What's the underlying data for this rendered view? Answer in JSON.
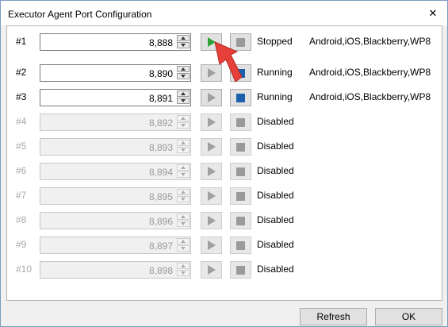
{
  "window": {
    "title": "Executor Agent Port Configuration",
    "close_glyph": "✕"
  },
  "rows": [
    {
      "label": "#1",
      "port": "8,888",
      "status": "Stopped",
      "platforms": "Android,iOS,Blackberry,WP8",
      "enabled": true,
      "play_active": true,
      "stop_active": false
    },
    {
      "label": "#2",
      "port": "8,890",
      "status": "Running",
      "platforms": "Android,iOS,Blackberry,WP8",
      "enabled": true,
      "play_active": false,
      "stop_active": true
    },
    {
      "label": "#3",
      "port": "8,891",
      "status": "Running",
      "platforms": "Android,iOS,Blackberry,WP8",
      "enabled": true,
      "play_active": false,
      "stop_active": true
    },
    {
      "label": "#4",
      "port": "8,892",
      "status": "Disabled",
      "platforms": "",
      "enabled": false,
      "play_active": false,
      "stop_active": false
    },
    {
      "label": "#5",
      "port": "8,893",
      "status": "Disabled",
      "platforms": "",
      "enabled": false,
      "play_active": false,
      "stop_active": false
    },
    {
      "label": "#6",
      "port": "8,894",
      "status": "Disabled",
      "platforms": "",
      "enabled": false,
      "play_active": false,
      "stop_active": false
    },
    {
      "label": "#7",
      "port": "8,895",
      "status": "Disabled",
      "platforms": "",
      "enabled": false,
      "play_active": false,
      "stop_active": false
    },
    {
      "label": "#8",
      "port": "8,896",
      "status": "Disabled",
      "platforms": "",
      "enabled": false,
      "play_active": false,
      "stop_active": false
    },
    {
      "label": "#9",
      "port": "8,897",
      "status": "Disabled",
      "platforms": "",
      "enabled": false,
      "play_active": false,
      "stop_active": false
    },
    {
      "label": "#10",
      "port": "8,898",
      "status": "Disabled",
      "platforms": "",
      "enabled": false,
      "play_active": false,
      "stop_active": false
    }
  ],
  "footer": {
    "refresh_label": "Refresh",
    "ok_label": "OK"
  },
  "icons": {
    "play": "play-icon",
    "stop": "stop-icon",
    "spin_up": "chevron-up-icon",
    "spin_down": "chevron-down-icon",
    "close": "close-icon",
    "pointer": "red-arrow-pointer-icon"
  },
  "colors": {
    "play_active": "#2fa33a",
    "stop_active": "#1b5fad",
    "pointer": "#e5413a"
  }
}
